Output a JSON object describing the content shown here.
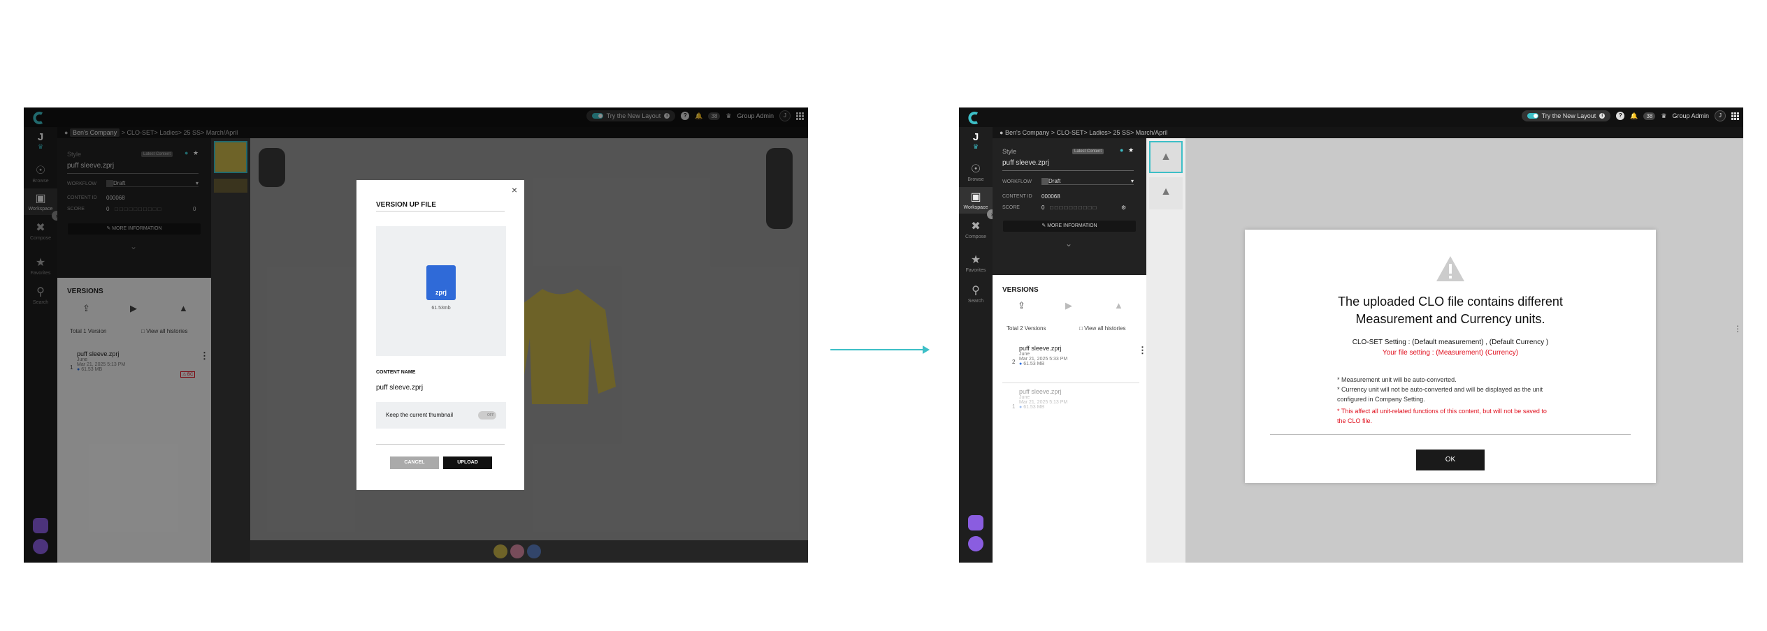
{
  "topbar": {
    "try_layout": "Try the New Layout",
    "notif_count": "38",
    "group_admin": "Group Admin",
    "user_initial": "J"
  },
  "breadcrumb": {
    "company": "Ben's Company",
    "path": "> CLO-SET> Ladies> 25 SS> March/April"
  },
  "rail": {
    "user_initial": "J",
    "items": [
      "Browse",
      "Workspace",
      "Compose",
      "Favorites",
      "Search"
    ]
  },
  "panel": {
    "type_label": "Style",
    "status_badge": "Latest Content",
    "name": "puff sleeve.zprj",
    "workflow_label": "WORKFLOW",
    "workflow_value": "Draft",
    "content_id_label": "CONTENT ID",
    "content_id": "000068",
    "score_label": "SCORE",
    "score_value": "0",
    "more_info": "MORE INFORMATION"
  },
  "left": {
    "versions_title": "VERSIONS",
    "total": "Total 1 Version",
    "view_all": "View all histories",
    "version": {
      "num": "1",
      "name": "puff sleeve.zprj",
      "owner": "June",
      "date": "Mar 21, 2025 5:13 PM",
      "size": "61.53 MB",
      "tag": "⚠ BC"
    },
    "modal": {
      "title": "VERSION UP FILE",
      "file_ext": "zprj",
      "file_size": "61.53mb",
      "content_name_label": "CONTENT NAME",
      "content_name": "puff sleeve.zprj",
      "keep_thumb": "Keep the current thumbnail",
      "toggle_off": "OFF",
      "cancel": "CANCEL",
      "upload": "UPLOAD"
    }
  },
  "right": {
    "versions_title": "VERSIONS",
    "total": "Total 2 Versions",
    "view_all": "View all histories",
    "versions": [
      {
        "num": "2",
        "name": "puff sleeve.zprj",
        "owner": "June",
        "date": "Mar 21, 2025 5:33 PM",
        "size": "61.53 MB"
      },
      {
        "num": "1",
        "name": "puff sleeve.zprj",
        "owner": "June",
        "date": "Mar 21, 2025 5:13 PM",
        "size": "61.53 MB"
      }
    ],
    "dialog": {
      "title1": "The uploaded CLO file contains different",
      "title2": "Measurement and Currency units.",
      "setting": "CLO-SET Setting  : (Default measurement) , (Default Currency )",
      "file_setting": "Your file setting  : (Measurement) (Currency)",
      "note1": "* Measurement unit will be auto-converted.",
      "note2a": "* Currency unit will not be auto-converted and will be displayed as the unit",
      "note2b": "configured in Company Setting.",
      "warn1": "* This affect all unit-related functions of this content, but will not be saved to",
      "warn2": "the CLO file.",
      "ok": "OK"
    }
  },
  "colors": {
    "accent": "#3dbfc7",
    "warning_red": "#e0101e",
    "dark_button": "#1a1a1a",
    "purple": "#8a5de0"
  }
}
